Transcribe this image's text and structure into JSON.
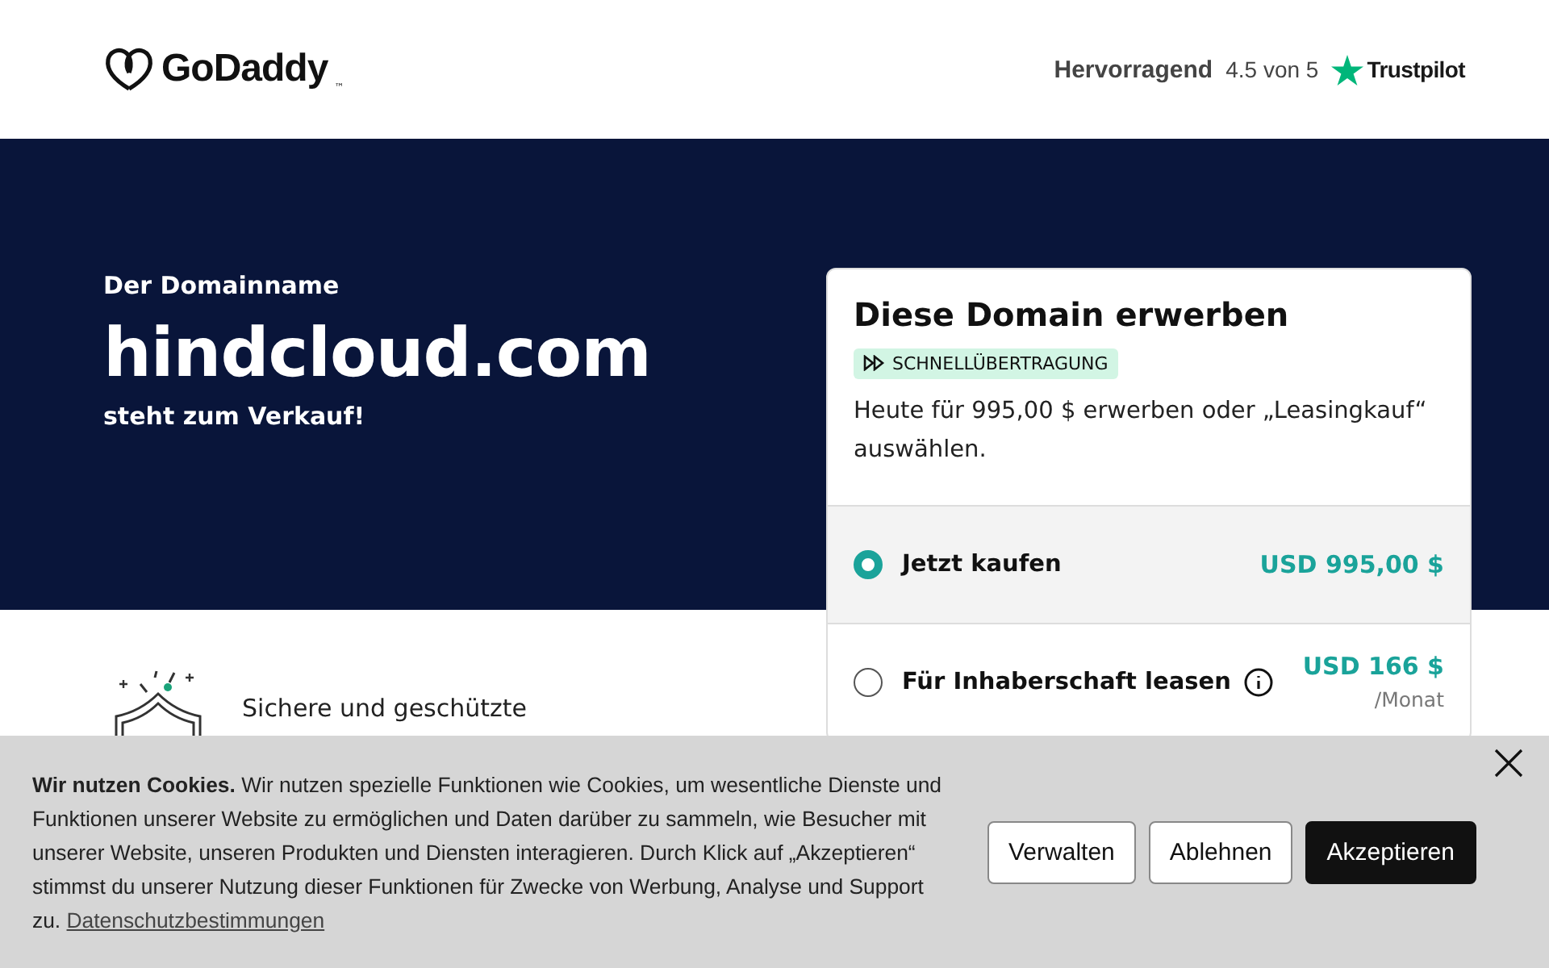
{
  "header": {
    "logo": "GoDaddy",
    "trademark": "™",
    "rating_label": "Hervorragend",
    "rating_score": "4.5 von 5",
    "rating_brand": "Trustpilot"
  },
  "hero": {
    "eyebrow": "Der Domainname",
    "domain": "hindcloud.com",
    "subtitle": "steht zum Verkauf!"
  },
  "card": {
    "title": "Diese Domain erwerben",
    "badge": "SCHNELLÜBERTRAGUNG",
    "description": "Heute für 995,00 $ erwerben oder „Leasingkauf“ auswählen.",
    "options": [
      {
        "label": "Jetzt kaufen",
        "price": "USD 995,00 $",
        "selected": true,
        "info": false
      },
      {
        "label": "Für Inhaberschaft leasen",
        "price": "USD 166 $",
        "period": "/Monat",
        "selected": false,
        "info": true
      }
    ]
  },
  "features": [
    {
      "text": "Sichere und geschützte"
    }
  ],
  "cookie_banner": {
    "text": "**Wir nutzen Cookies.** Wir nutzen spezielle Funktionen wie Cookies, um wesentliche Dienste und Funktionen unserer Website zu ermöglichen und Daten darüber zu sammeln, wie Besucher mit unserer Website, unseren Produkten und Diensten interagieren. Durch Klick auf „Akzeptieren“ stimmst du unserer Nutzung dieser Funktionen für Zwecke von Werbung, Analyse und Support zu.",
    "link": "Datenschutzbestimmungen",
    "buttons": [
      {
        "label": "Verwalten",
        "kind": "outline"
      },
      {
        "label": "Ablehnen",
        "kind": "outline"
      },
      {
        "label": "Akzeptieren",
        "kind": "primary"
      }
    ]
  }
}
